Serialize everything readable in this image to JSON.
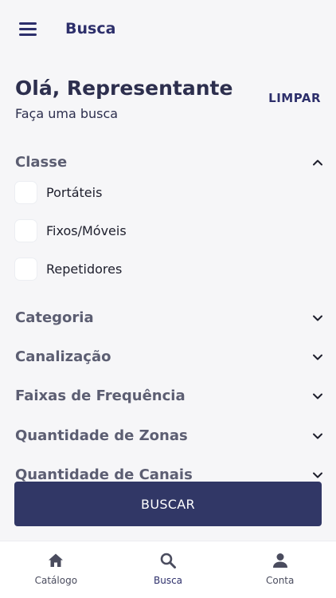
{
  "header": {
    "title": "Busca"
  },
  "intro": {
    "greeting": "Olá, Representante",
    "subtitle": "Faça uma busca",
    "clear_label": "LIMPAR"
  },
  "filters": {
    "classe": {
      "label": "Classe",
      "expanded": true,
      "options": [
        {
          "label": "Portáteis",
          "checked": false
        },
        {
          "label": "Fixos/Móveis",
          "checked": false
        },
        {
          "label": "Repetidores",
          "checked": false
        }
      ]
    },
    "categoria": {
      "label": "Categoria",
      "expanded": false
    },
    "canalizacao": {
      "label": "Canalização",
      "expanded": false
    },
    "faixas": {
      "label": "Faixas de Frequência",
      "expanded": false
    },
    "zonas": {
      "label": "Quantidade de Zonas",
      "expanded": false
    },
    "canais": {
      "label": "Quantidade de Canais",
      "expanded": false
    }
  },
  "search_button": {
    "label": "BUSCAR"
  },
  "bottom_nav": {
    "items": [
      {
        "label": "Catálogo",
        "icon": "home-icon",
        "active": false
      },
      {
        "label": "Busca",
        "icon": "search-icon",
        "active": true
      },
      {
        "label": "Conta",
        "icon": "person-icon",
        "active": false
      }
    ]
  },
  "colors": {
    "primary": "#313766",
    "text": "#2d2f4e",
    "section_label": "#5c5e72",
    "background": "#f6f6f8"
  }
}
